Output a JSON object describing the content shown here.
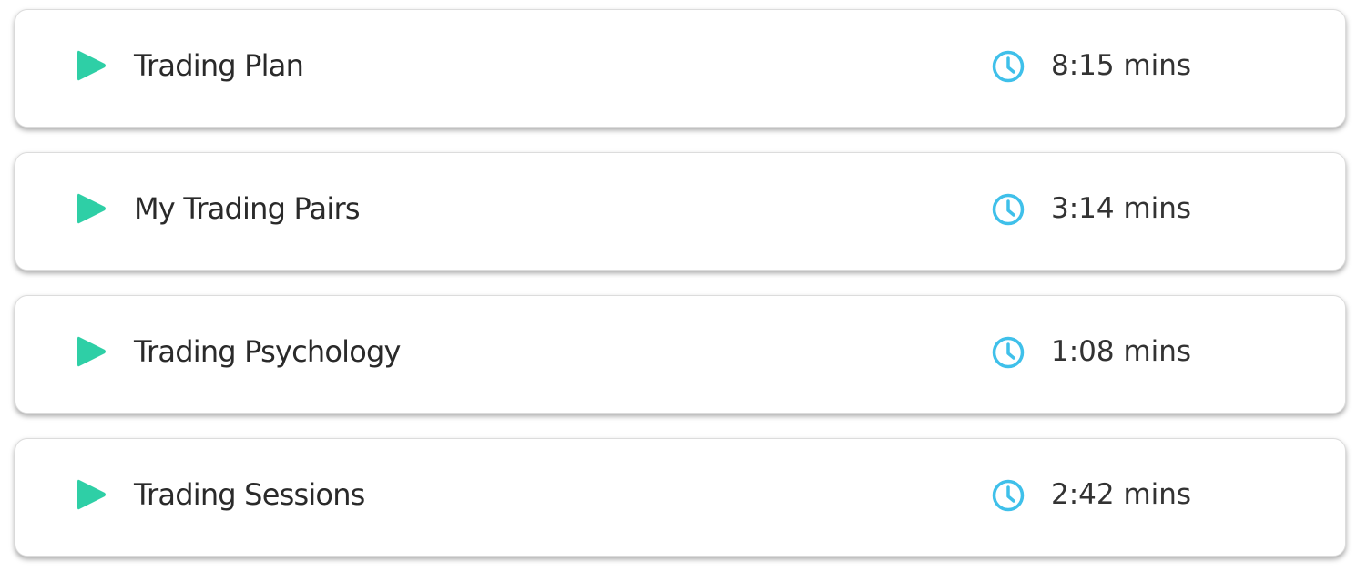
{
  "colors": {
    "play_icon": "#2ecfa6",
    "clock_icon": "#3fc0ea",
    "title_text": "#2a2a2a",
    "duration_text": "#333333"
  },
  "icons": {
    "play": "play-icon",
    "clock": "clock-icon"
  },
  "lessons": [
    {
      "title": "Trading Plan",
      "duration": "8:15 mins"
    },
    {
      "title": "My Trading Pairs",
      "duration": "3:14 mins"
    },
    {
      "title": "Trading Psychology",
      "duration": "1:08 mins"
    },
    {
      "title": "Trading Sessions",
      "duration": "2:42 mins"
    }
  ]
}
